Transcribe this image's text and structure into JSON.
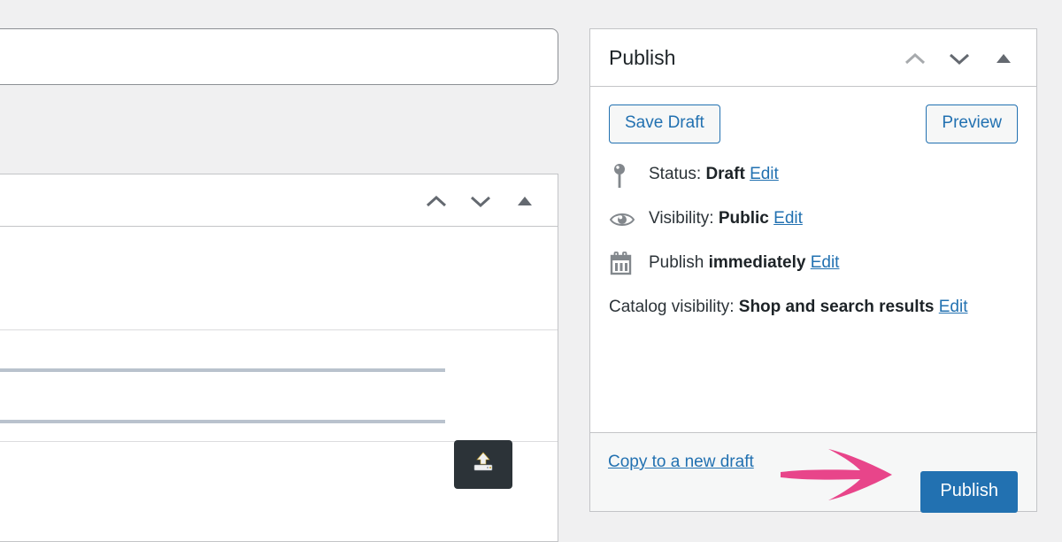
{
  "theme": {
    "page_background": "#f0f0f1",
    "panel_background": "#ffffff",
    "panel_border": "#c3c4c7",
    "footer_background": "#f6f7f7",
    "accent_blue": "#2271b1",
    "text_dark": "#1d2327",
    "text_body": "#2c3338",
    "annotation_pink": "#e8458a",
    "upload_button_dark": "#2c3338"
  },
  "left_editor": {
    "title_field": {
      "value": "",
      "placeholder": ""
    },
    "metabox": {
      "title": "",
      "handle_icons": [
        "chevron-up-icon",
        "chevron-down-icon",
        "triangle-up-icon"
      ],
      "field_value": "",
      "upload_icon": "upload-icon"
    }
  },
  "publish_panel": {
    "header": {
      "title": "Publish",
      "order_up_icon": "chevron-up-icon",
      "order_down_icon": "chevron-down-icon",
      "toggle_icon": "triangle-up-icon"
    },
    "actions": {
      "save_draft_label": "Save Draft",
      "preview_label": "Preview"
    },
    "status_rows": [
      {
        "icon": "pin-icon",
        "label": "Status:",
        "value": "Draft",
        "edit_label": "Edit"
      },
      {
        "icon": "eye-icon",
        "label": "Visibility:",
        "value": "Public",
        "edit_label": "Edit"
      },
      {
        "icon": "calendar-icon",
        "label": "Publish",
        "value": "immediately",
        "edit_label": "Edit"
      }
    ],
    "catalog_visibility": {
      "label": "Catalog visibility:",
      "value": "Shop and search results",
      "edit_label": "Edit"
    },
    "footer": {
      "copy_draft_label": "Copy to a new draft",
      "publish_label": "Publish"
    }
  },
  "annotation": {
    "arrow_icon": "right-arrow-icon",
    "color": "#e8458a",
    "points_to": "Publish"
  }
}
